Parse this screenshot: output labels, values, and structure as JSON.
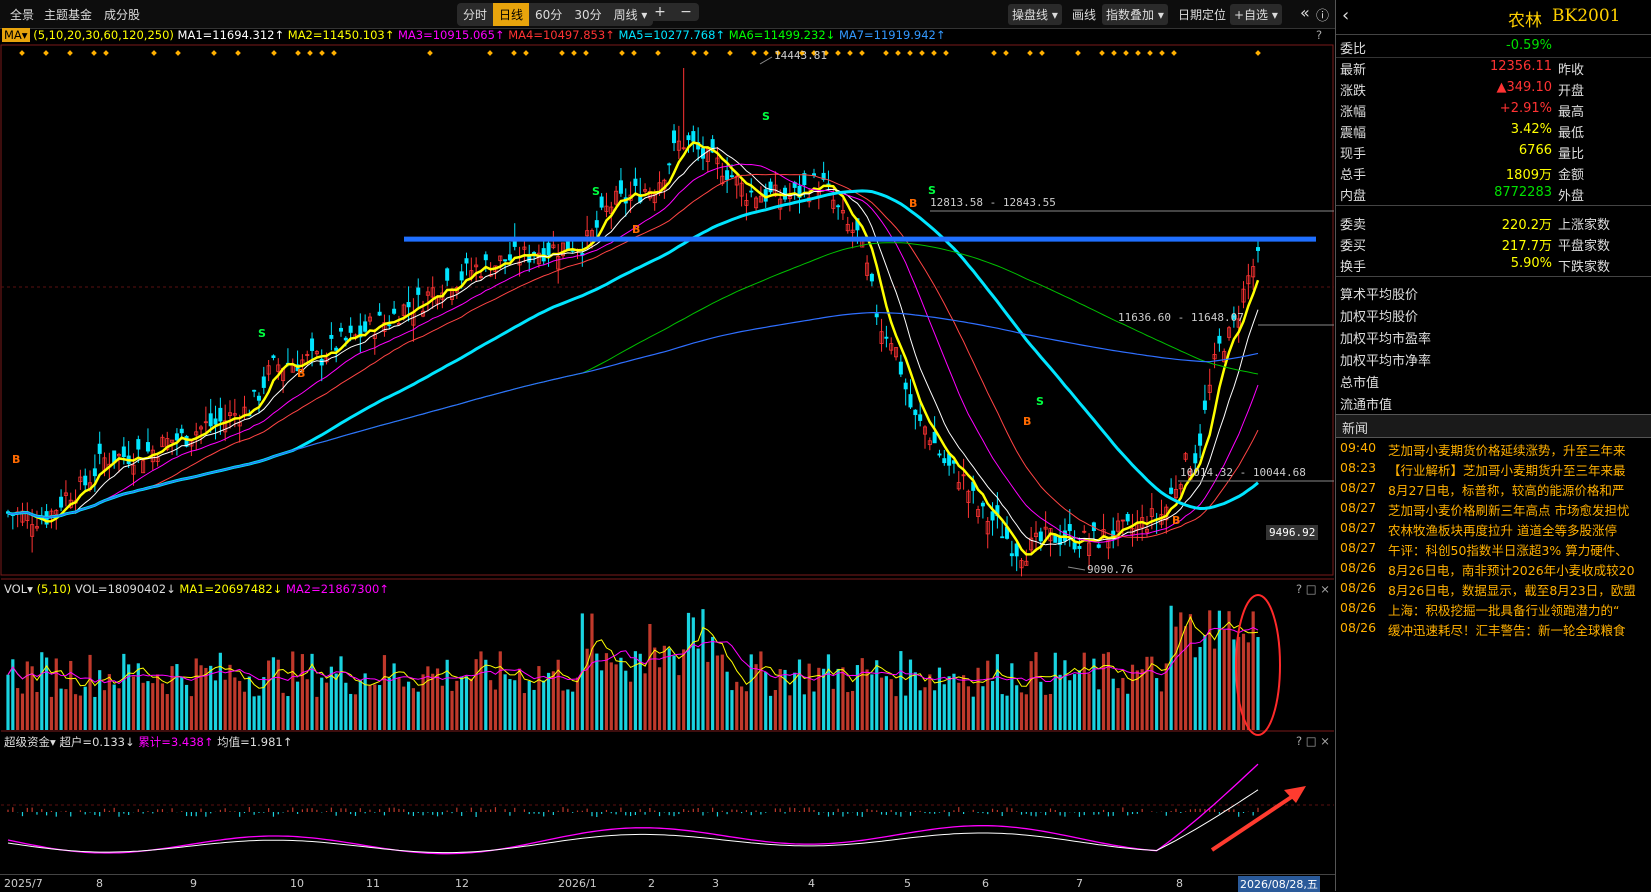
{
  "topbar": {
    "nav": [
      "全景",
      "主题基金",
      "成分股"
    ],
    "periods": [
      "分时",
      "日线",
      "60分",
      "30分",
      "周线 ▾"
    ],
    "active_period": "日线",
    "zoom_in": "+",
    "zoom_out": "−",
    "tools": [
      "操盘线 ▾",
      "画线",
      "指数叠加 ▾",
      "日期定位",
      "+自选 ▾"
    ],
    "collapse": "«"
  },
  "main_legend": {
    "ma_button": "MA▾",
    "params": "(5,10,20,30,60,120,250)",
    "ma": [
      {
        "label": "MA1=11694.312↑",
        "color": "#ffffff"
      },
      {
        "label": "MA2=11450.103↑",
        "color": "#ffff00"
      },
      {
        "label": "MA3=10915.065↑",
        "color": "#ff00ff"
      },
      {
        "label": "MA4=10497.853↑",
        "color": "#ff3333"
      },
      {
        "label": "MA5=10277.768↑",
        "color": "#00e5ff"
      },
      {
        "label": "MA6=11499.232↓",
        "color": "#00ff00"
      },
      {
        "label": "MA7=11919.942↑",
        "color": "#3399ff"
      }
    ]
  },
  "price_labels": {
    "high": "14443.81",
    "range1": "12813.58 - 12843.55",
    "range2": "11636.60 - 11648.07",
    "range3": "10014.32 - 10044.68",
    "low": "9090.76",
    "axis_price": "9496.92"
  },
  "vol_legend": {
    "name": "VOL▾",
    "params": "(5,10)",
    "vol": "VOL=18090402↓",
    "ma1": "MA1=20697482↓",
    "ma2": "MA2=21867300↑"
  },
  "fund_legend": {
    "name": "超级资金▾",
    "super": "超户=0.133↓",
    "cum": "累计=3.438↑",
    "avg": "均值=1.981↑"
  },
  "xaxis": {
    "labels": [
      "2025/7",
      "8",
      "9",
      "10",
      "11",
      "12",
      "2026/1",
      "2",
      "3",
      "4",
      "5",
      "6",
      "7",
      "8"
    ],
    "current": "2026/08/28,五"
  },
  "quote": {
    "name": "农林",
    "code": "BK2001",
    "rows": [
      {
        "label": "委比",
        "value": "-0.59%",
        "color": "#00e000",
        "label2": ""
      },
      {
        "label": "最新",
        "value": "12356.11",
        "color": "#ff3333",
        "label2": "昨收"
      },
      {
        "label": "涨跌",
        "value": "▲349.10",
        "color": "#ff3333",
        "label2": "开盘"
      },
      {
        "label": "涨幅",
        "value": "+2.91%",
        "color": "#ff3333",
        "label2": "最高"
      },
      {
        "label": "震幅",
        "value": "3.42%",
        "color": "#ffff00",
        "label2": "最低"
      },
      {
        "label": "现手",
        "value": "6766",
        "color": "#ffff00",
        "label2": "量比"
      },
      {
        "label": "总手",
        "value": "1809万",
        "color": "#ffff00",
        "label2": "金额"
      },
      {
        "label": "内盘",
        "value": "8772283",
        "color": "#00e000",
        "label2": "外盘"
      }
    ],
    "rows2": [
      {
        "label": "委卖",
        "value": "220.2万",
        "color": "#ffff00",
        "label2": "上涨家数"
      },
      {
        "label": "委买",
        "value": "217.7万",
        "color": "#ffff00",
        "label2": "平盘家数"
      },
      {
        "label": "换手",
        "value": "5.90%",
        "color": "#ffff00",
        "label2": "下跌家数"
      }
    ],
    "stats": [
      "算术平均股价",
      "加权平均股价",
      "加权平均市盈率",
      "加权平均市净率",
      "总市值",
      "流通市值"
    ]
  },
  "news": {
    "title": "新闻",
    "items": [
      {
        "time": "09:40",
        "headline": "芝加哥小麦期货价格延续涨势，升至三年来"
      },
      {
        "time": "08:23",
        "headline": "【行业解析】芝加哥小麦期货升至三年来最"
      },
      {
        "time": "08/27",
        "headline": "8月27日电，标普称，较高的能源价格和严"
      },
      {
        "time": "08/27",
        "headline": "芝加哥小麦价格刷新三年高点 市场愈发担忧"
      },
      {
        "time": "08/27",
        "headline": "农林牧渔板块再度拉升 道道全等多股涨停"
      },
      {
        "time": "08/27",
        "headline": "午评：科创50指数半日涨超3% 算力硬件、"
      },
      {
        "time": "08/26",
        "headline": "8月26日电，南非预计2026年小麦收成较20"
      },
      {
        "time": "08/26",
        "headline": "8月26日电，数据显示，截至8月23日，欧盟"
      },
      {
        "time": "08/26",
        "headline": "上海：积极挖掘一批具备行业领跑潜力的“"
      },
      {
        "time": "08/26",
        "headline": "缓冲迅速耗尽！汇丰警告：新一轮全球粮食"
      }
    ]
  },
  "colors": {
    "up": "#ff3333",
    "down": "#00e5ff",
    "accent": "#e8a40c",
    "ma5": "#ffff00",
    "ma20": "#ff00ff",
    "ma30": "#ff4444",
    "ma60": "#00e5ff",
    "ma120": "#00c000",
    "ma250": "#2f6fff"
  },
  "chart_data": {
    "type": "candlestick",
    "ylim": [
      9090.76,
      14443.81
    ],
    "x": [
      "2025/7",
      "8",
      "9",
      "10",
      "11",
      "12",
      "2026/1",
      "2",
      "3",
      "4",
      "5",
      "6",
      "7",
      "8"
    ],
    "close": [
      9650,
      9600,
      9900,
      10250,
      10300,
      10450,
      10600,
      10750,
      11250,
      11300,
      11500,
      11700,
      11900,
      12150,
      12300,
      12400,
      12500,
      12550,
      13000,
      13150,
      13650,
      13400,
      13100,
      13050,
      13200,
      12700,
      11600,
      10600,
      10100,
      9600,
      9250,
      9400,
      9350,
      9450,
      9600,
      10200,
      11500,
      12356.11
    ],
    "support_level": 12600
  }
}
